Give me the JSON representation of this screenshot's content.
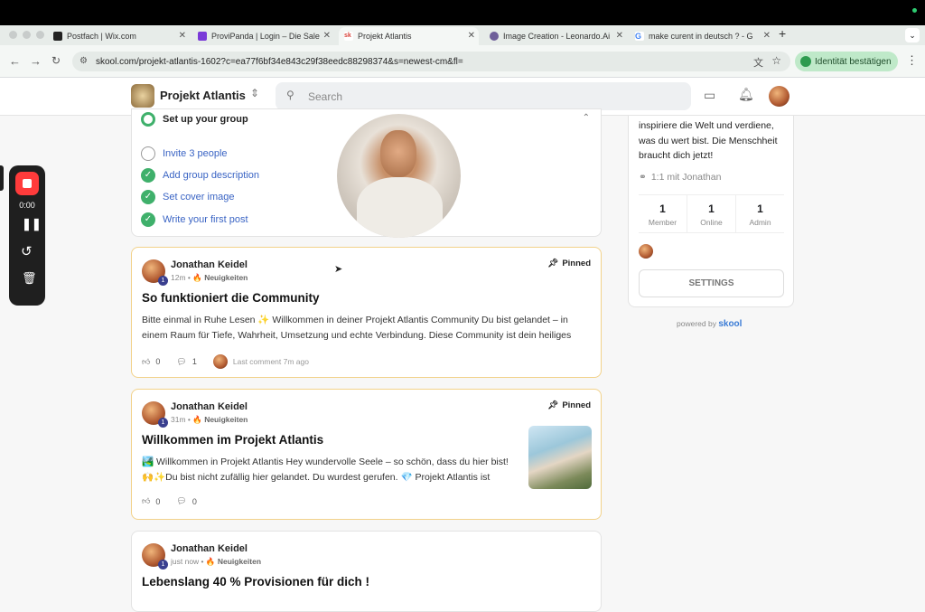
{
  "browser": {
    "tabs": [
      {
        "title": "Postfach | Wix.com",
        "color": "#222"
      },
      {
        "title": "ProviPanda | Login – Die Sale",
        "color": "#7a3ad8"
      },
      {
        "title": "Projekt Atlantis",
        "color": "#d8433a"
      },
      {
        "title": "Image Creation - Leonardo.Ai",
        "color": "#6f5f9a"
      },
      {
        "title": "make curent in deutsch ? - G",
        "color": "#4285f4"
      }
    ],
    "new_tab": "+",
    "url": "skool.com/projekt-atlantis-1602?c=ea77f6bf34e843c29f38eedc88298374&s=newest-cm&fl=",
    "verify_label": "Identität bestätigen"
  },
  "header": {
    "group_name": "Projekt Atlantis",
    "search_placeholder": "Search"
  },
  "setup": {
    "title": "Set up your group",
    "items": [
      {
        "label": "Invite 3 people",
        "done": false
      },
      {
        "label": "Add group description",
        "done": true
      },
      {
        "label": "Set cover image",
        "done": true
      },
      {
        "label": "Write your first post",
        "done": true
      }
    ]
  },
  "recorder": {
    "time": "0:00"
  },
  "posts": [
    {
      "author": "Jonathan Keidel",
      "level": "1",
      "time": "12m",
      "category": "🔥 Neuigkeiten",
      "pinned": "Pinned",
      "title": "So funktioniert die Community",
      "body": "Bitte einmal in Ruhe Lesen ✨ Willkommen in deiner Projekt Atlantis Community Du bist gelandet – in einem Raum für Tiefe, Wahrheit, Umsetzung und echte Verbindung. Diese Community ist dein heiliges",
      "likes": "0",
      "comments": "1",
      "last_comment": "Last comment 7m ago"
    },
    {
      "author": "Jonathan Keidel",
      "level": "1",
      "time": "31m",
      "category": "🔥 Neuigkeiten",
      "pinned": "Pinned",
      "title": "Willkommen im Projekt Atlantis",
      "body": "🏞️ Willkommen in Projekt Atlantis Hey wundervolle Seele – so schön, dass du hier bist! 🙌✨Du bist nicht zufällig hier gelandet. Du wurdest gerufen. 💎 Projekt Atlantis ist",
      "likes": "0",
      "comments": "0"
    },
    {
      "author": "Jonathan Keidel",
      "level": "1",
      "time": "just now",
      "category": "🔥 Neuigkeiten",
      "title": "Lebenslang 40 % Provisionen für dich !"
    }
  ],
  "sidebar": {
    "description": "inspiriere die Welt und verdiene, was du wert bist. Die Menschheit braucht dich jetzt!",
    "link": "1:1 mit Jonathan",
    "stats": [
      {
        "value": "1",
        "label": "Member"
      },
      {
        "value": "1",
        "label": "Online"
      },
      {
        "value": "1",
        "label": "Admin"
      }
    ],
    "settings": "SETTINGS",
    "powered_by": "powered by",
    "brand": "skool"
  }
}
